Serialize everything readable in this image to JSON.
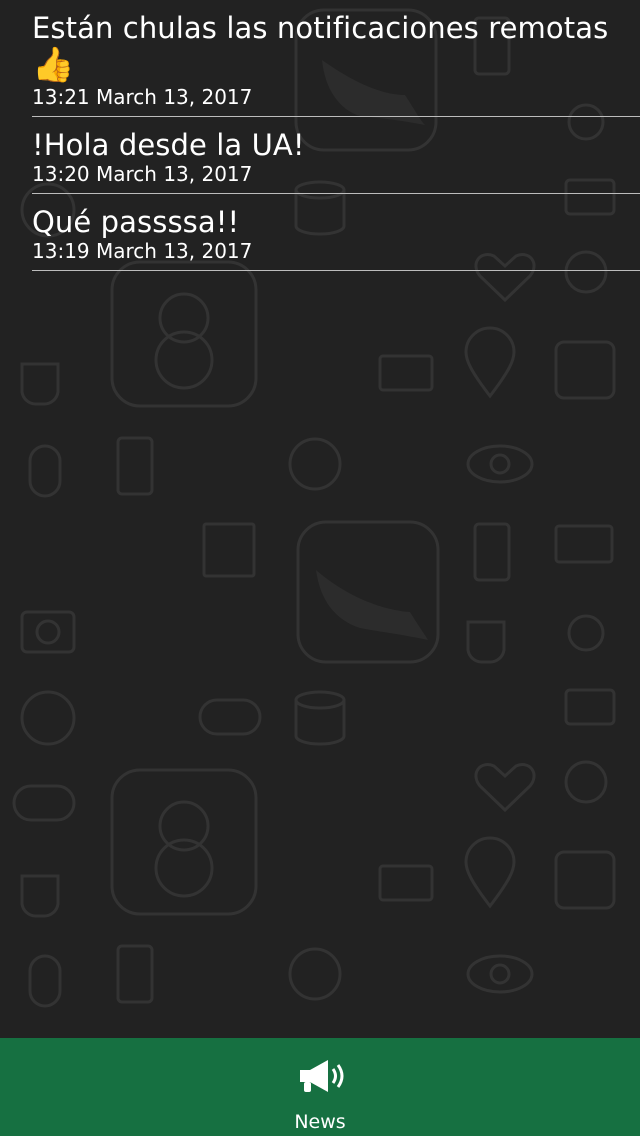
{
  "notifications": [
    {
      "message": "Están chulas las notificaciones remotas",
      "emoji": "👍",
      "timestamp": "13:21 March 13, 2017"
    },
    {
      "message": "!Hola desde la UA!",
      "timestamp": "13:20 March 13, 2017"
    },
    {
      "message": "Qué passssa!!",
      "timestamp": "13:19 March 13, 2017"
    }
  ],
  "tabbar": {
    "tabs": [
      {
        "label": "News",
        "icon": "megaphone-icon"
      }
    ]
  },
  "colors": {
    "background": "#222222",
    "tabbar": "#167041",
    "separator": "#bdbdbd"
  }
}
